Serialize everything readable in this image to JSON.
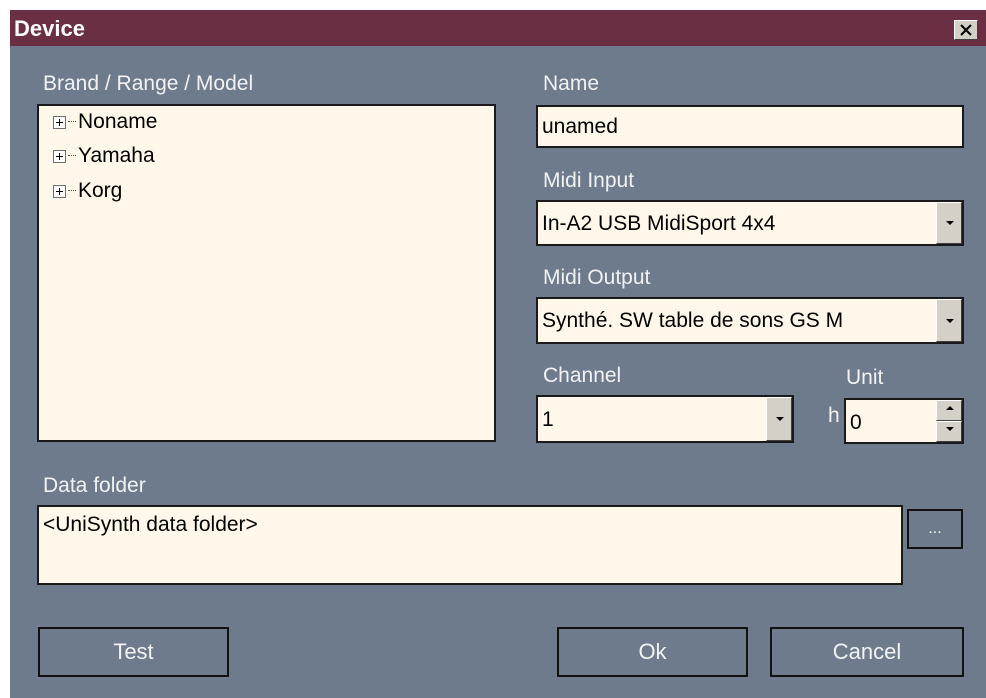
{
  "window": {
    "title": "Device"
  },
  "tree": {
    "label": "Brand / Range / Model",
    "items": [
      {
        "label": "Noname"
      },
      {
        "label": "Yamaha"
      },
      {
        "label": "Korg"
      }
    ]
  },
  "name": {
    "label": "Name",
    "value": "unamed"
  },
  "midi_input": {
    "label": "Midi Input",
    "value": "In-A2 USB MidiSport 4x4"
  },
  "midi_output": {
    "label": "Midi Output",
    "value": "Synthé. SW table de sons GS M"
  },
  "channel": {
    "label": "Channel",
    "value": "1"
  },
  "unit": {
    "label": "Unit",
    "prefix": "h",
    "value": "0"
  },
  "data_folder": {
    "label": "Data folder",
    "value": "<UniSynth data folder>",
    "browse_label": "..."
  },
  "buttons": {
    "test": "Test",
    "ok": "Ok",
    "cancel": "Cancel"
  },
  "colors": {
    "title_bar": "#6b2f43",
    "dialog_background": "#6d7b8d",
    "field_background": "#fff8ea"
  }
}
